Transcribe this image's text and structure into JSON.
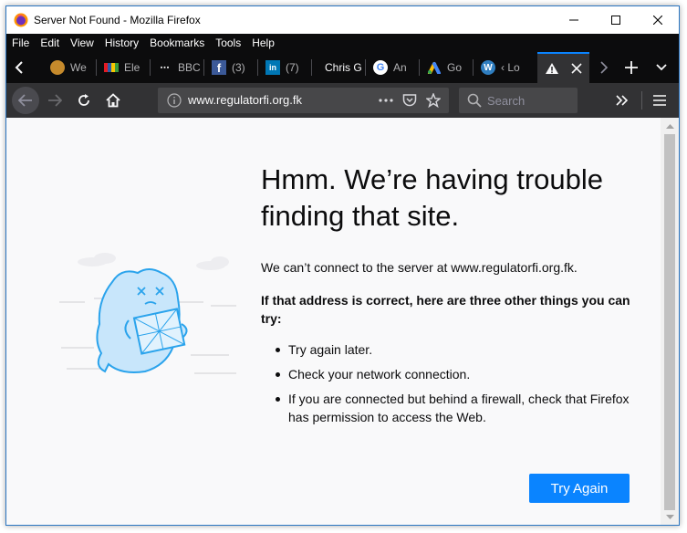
{
  "window": {
    "title": "Server Not Found - Mozilla Firefox"
  },
  "menu": {
    "items": [
      {
        "label": "File",
        "name": "menu-file"
      },
      {
        "label": "Edit",
        "name": "menu-edit"
      },
      {
        "label": "View",
        "name": "menu-view"
      },
      {
        "label": "History",
        "name": "menu-history"
      },
      {
        "label": "Bookmarks",
        "name": "menu-bookmarks"
      },
      {
        "label": "Tools",
        "name": "menu-tools"
      },
      {
        "label": "Help",
        "name": "menu-help"
      }
    ]
  },
  "tabs": [
    {
      "label": "We",
      "icon": "site-icon"
    },
    {
      "label": "Ele",
      "icon": "color-bars-icon"
    },
    {
      "label": "BBC",
      "icon": "bbc-icon"
    },
    {
      "label": "(3)",
      "icon": "facebook-icon"
    },
    {
      "label": "(7)",
      "icon": "linkedin-icon"
    },
    {
      "label": "Chris G",
      "icon": ""
    },
    {
      "label": "An",
      "icon": "google-icon"
    },
    {
      "label": "Go",
      "icon": "google-ads-icon"
    },
    {
      "label": "‹ Lo",
      "icon": "wordpress-icon"
    },
    {
      "label": "",
      "icon": "warning-icon",
      "active": true
    }
  ],
  "navbar": {
    "url": "www.regulatorfi.org.fk",
    "search_placeholder": "Search"
  },
  "error": {
    "title": "Hmm. We’re having trouble finding that site.",
    "description": "We can’t connect to the server at www.regulatorfi.org.fk.",
    "suggestion_heading": "If that address is correct, here are three other things you can try:",
    "suggestions": [
      "Try again later.",
      "Check your network connection.",
      "If you are connected but behind a firewall, check that Firefox has permission to access the Web."
    ],
    "try_again_label": "Try Again"
  },
  "colors": {
    "accent": "#0a84ff",
    "chrome_dark": "#0c0c0d",
    "toolbar": "#323234",
    "content_bg": "#f9f9fa"
  }
}
